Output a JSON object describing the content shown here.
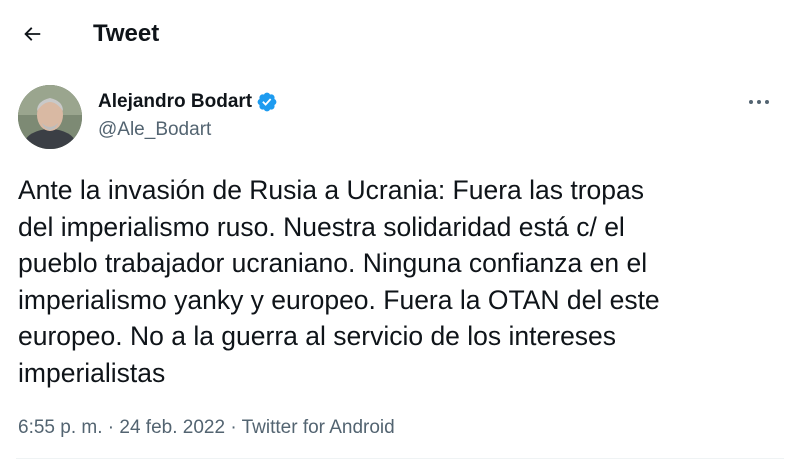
{
  "header": {
    "back_icon": "arrow-left-icon",
    "title": "Tweet"
  },
  "author": {
    "display_name": "Alejandro Bodart",
    "handle": "@Ale_Bodart",
    "verified": true,
    "verified_color": "#1d9bf0"
  },
  "tweet": {
    "text": "Ante la invasión de Rusia a Ucrania: Fuera las tropas\ndel imperialismo ruso. Nuestra solidaridad está c/ el\npueblo trabajador ucraniano. Ninguna confianza en el\nimperialismo yanky y europeo. Fuera la OTAN del este\neuropeo. No a la guerra al servicio de los intereses\nimperialistas",
    "time": "6:55 p. m.",
    "separator": "·",
    "date": "24 feb. 2022",
    "source": "Twitter for Android"
  },
  "colors": {
    "text": "#0f1419",
    "secondary": "#536471",
    "accent": "#1d9bf0"
  }
}
